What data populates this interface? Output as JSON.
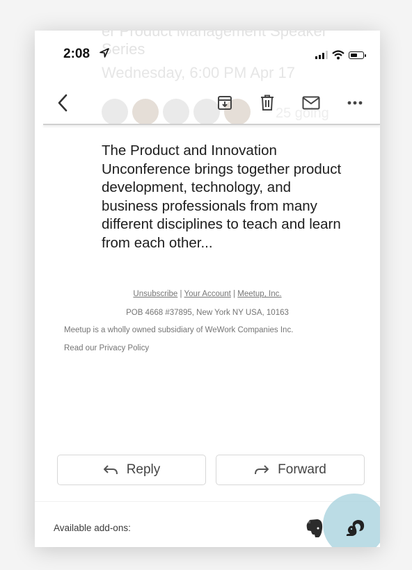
{
  "ghost": {
    "title_line1": "er Product Management Speaker",
    "title_line2": "Series",
    "datetime": "Wednesday, 6:00 PM Apr 17",
    "going": "25 going"
  },
  "status_bar": {
    "time": "2:08"
  },
  "toolbar": {
    "back_icon": "chevron-left-icon",
    "archive_icon": "archive-icon",
    "delete_icon": "trash-icon",
    "mail_icon": "mail-icon",
    "more_icon": "more-horizontal-icon"
  },
  "email": {
    "description": "The Product and Innovation Unconference brings together product development, technology, and business professionals from many different disciplines to teach and learn from each other..."
  },
  "footer": {
    "unsubscribe": "Unsubscribe",
    "sep": "|",
    "your_account": "Your Account",
    "meetup_inc": "Meetup, Inc.",
    "address": "POB 4668 #37895, New York NY USA, 10163",
    "subsidiary": "Meetup is a wholly owned subsidiary of WeWork Companies Inc.",
    "privacy": "Read our Privacy Policy"
  },
  "actions": {
    "reply": "Reply",
    "forward": "Forward"
  },
  "addons": {
    "label": "Available add-ons:"
  },
  "colors": {
    "highlight": "#aad3de",
    "addon_icon": "#222222"
  }
}
